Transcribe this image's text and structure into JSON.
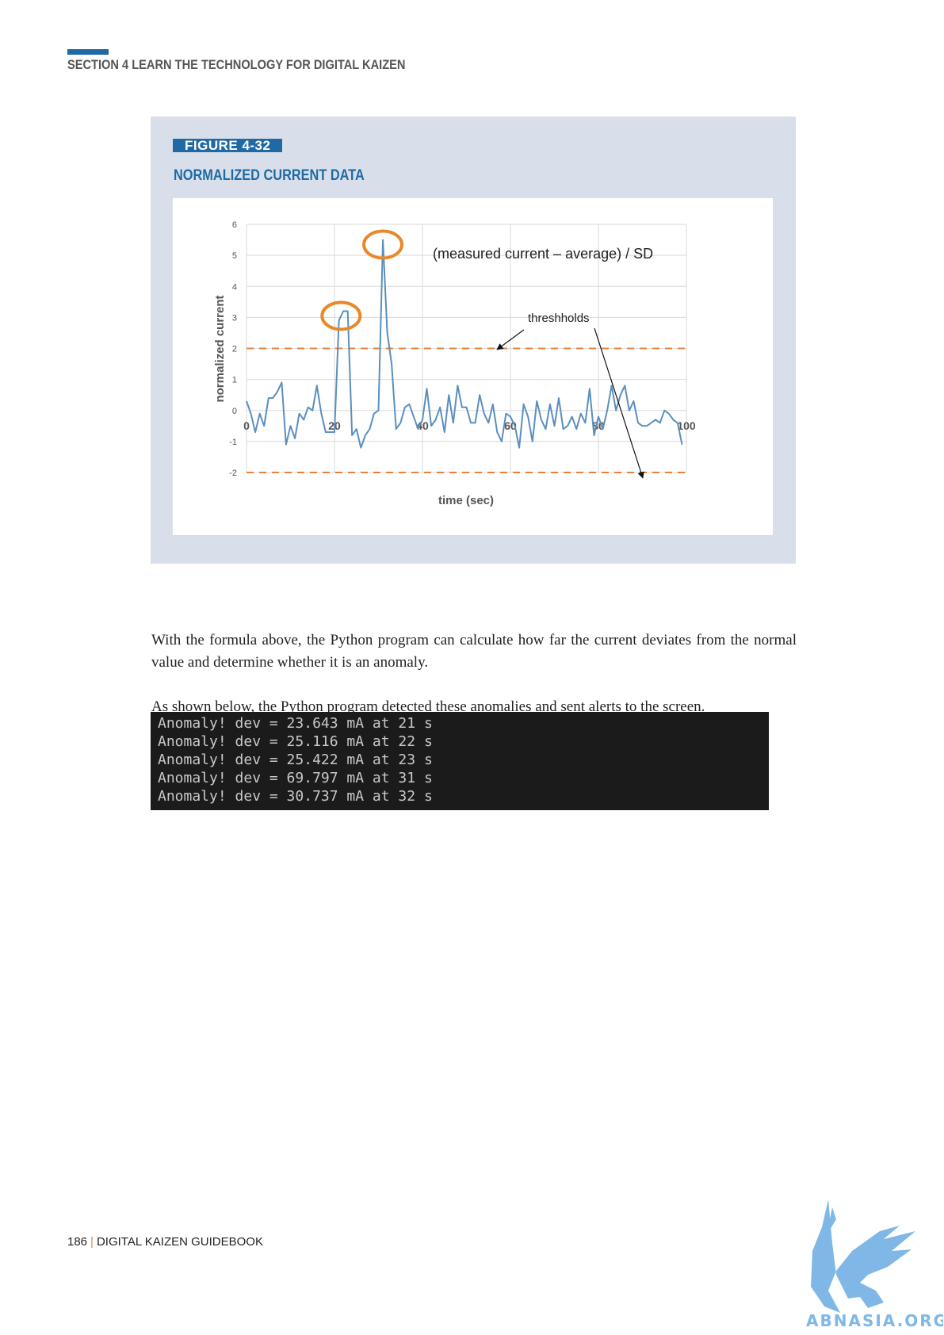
{
  "header": {
    "section": "SECTION 4  LEARN THE TECHNOLOGY FOR DIGITAL KAIZEN"
  },
  "figure": {
    "tag": "FIGURE 4-32",
    "title": "NORMALIZED CURRENT DATA"
  },
  "chart_data": {
    "type": "line",
    "title": "",
    "xlabel": "time (sec)",
    "ylabel": "normalized current",
    "xlim": [
      0,
      100
    ],
    "ylim": [
      -2,
      6
    ],
    "x_ticks": [
      "0",
      "20",
      "40",
      "60",
      "80",
      "100"
    ],
    "y_ticks": [
      "6",
      "5",
      "4",
      "3",
      "2",
      "1",
      "0",
      "-1",
      "-2"
    ],
    "grid": true,
    "annotations": {
      "formula": "(measured current – average) / SD",
      "thresholds": "threshholds"
    },
    "threshold_values": [
      2,
      -2
    ],
    "highlighted_points": [
      {
        "x": 21.5,
        "y": 3.1
      },
      {
        "x": 31,
        "y": 5.4
      }
    ],
    "colors": {
      "line": "#5a8fbf",
      "threshold": "#e8803a",
      "highlight": "#e8882a"
    },
    "series": [
      {
        "x": [
          0,
          1,
          2,
          3,
          4,
          5,
          6,
          7,
          8,
          9,
          10,
          11,
          12,
          13,
          14,
          15,
          16,
          17,
          18,
          19,
          20,
          21,
          22,
          23,
          24,
          25,
          26,
          27,
          28,
          29,
          30,
          31,
          32,
          33,
          34,
          35,
          36,
          37,
          38,
          39,
          40,
          41,
          42,
          43,
          44,
          45,
          46,
          47,
          48,
          49,
          50,
          51,
          52,
          53,
          54,
          55,
          56,
          57,
          58,
          59,
          60,
          61,
          62,
          63,
          64,
          65,
          66,
          67,
          68,
          69,
          70,
          71,
          72,
          73,
          74,
          75,
          76,
          77,
          78,
          79,
          80,
          81,
          82,
          83,
          84,
          85,
          86,
          87,
          88,
          89,
          90,
          91,
          92,
          93,
          94,
          95,
          96,
          97,
          98,
          99
        ],
        "y": [
          0.3,
          -0.1,
          -0.7,
          -0.1,
          -0.5,
          0.4,
          0.4,
          0.6,
          0.9,
          -1.1,
          -0.5,
          -0.9,
          -0.1,
          -0.3,
          0.1,
          0.0,
          0.8,
          -0.1,
          -0.7,
          -0.7,
          -0.7,
          2.9,
          3.2,
          3.2,
          -0.8,
          -0.6,
          -1.2,
          -0.8,
          -0.6,
          -0.1,
          0.0,
          5.5,
          2.5,
          1.5,
          -0.6,
          -0.4,
          0.1,
          0.2,
          -0.2,
          -0.6,
          -0.3,
          0.7,
          -0.5,
          -0.3,
          0.1,
          -0.7,
          0.5,
          -0.4,
          0.8,
          0.1,
          0.1,
          -0.4,
          -0.4,
          0.5,
          -0.1,
          -0.4,
          0.2,
          -0.7,
          -1.0,
          -0.1,
          -0.2,
          -0.5,
          -1.2,
          0.2,
          -0.2,
          -1.0,
          0.3,
          -0.3,
          -0.6,
          0.2,
          -0.5,
          0.4,
          -0.6,
          -0.5,
          -0.2,
          -0.6,
          -0.1,
          -0.4,
          0.7,
          -0.8,
          -0.2,
          -0.6,
          0.0,
          0.8,
          0.0,
          0.5,
          0.8,
          0.0,
          0.3,
          -0.4,
          -0.5,
          -0.5,
          -0.4,
          -0.3,
          -0.4,
          0.0,
          -0.1,
          -0.3,
          -0.4,
          -1.1
        ]
      }
    ]
  },
  "paragraphs": {
    "p1": "With the formula above, the Python program can calculate how far the current deviates from the normal value and determine whether it is an anomaly.",
    "p2": "As shown below, the Python program detected these anomalies and sent alerts to the screen."
  },
  "terminal": {
    "lines": [
      "Anomaly! dev = 23.643 mA at 21 s",
      "Anomaly! dev = 25.116 mA at 22 s",
      "Anomaly! dev = 25.422 mA at 23 s",
      "Anomaly! dev = 69.797 mA at 31 s",
      "Anomaly! dev = 30.737 mA at 32 s"
    ]
  },
  "footer": {
    "page": "186",
    "book": "DIGITAL KAIZEN GUIDEBOOK"
  },
  "watermark": {
    "text": "ABNASIA.ORG",
    "color": "#7fb8e6"
  }
}
